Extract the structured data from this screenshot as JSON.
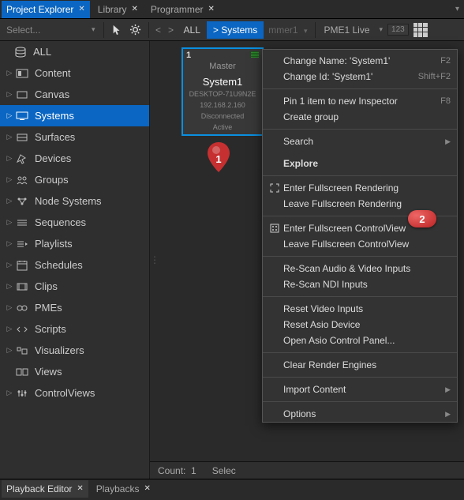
{
  "tabs": {
    "active": "Project Explorer",
    "others": [
      "Library",
      "Programmer"
    ]
  },
  "toolbar": {
    "select_placeholder": "Select...",
    "crumb_all": "ALL",
    "crumb_systems": "> Systems",
    "mmer": "mmer1",
    "pme": "PME1 Live",
    "num": "123"
  },
  "sidebar": {
    "all": "ALL",
    "items": [
      {
        "label": "Content"
      },
      {
        "label": "Canvas"
      },
      {
        "label": "Systems"
      },
      {
        "label": "Surfaces"
      },
      {
        "label": "Devices"
      },
      {
        "label": "Groups"
      },
      {
        "label": "Node Systems"
      },
      {
        "label": "Sequences"
      },
      {
        "label": "Playlists"
      },
      {
        "label": "Schedules"
      },
      {
        "label": "Clips"
      },
      {
        "label": "PMEs"
      },
      {
        "label": "Scripts"
      },
      {
        "label": "Visualizers"
      },
      {
        "label": "Views"
      },
      {
        "label": "ControlViews"
      }
    ]
  },
  "card": {
    "num": "1",
    "role": "Master",
    "title": "System1",
    "host": "DESKTOP-71U9N2E",
    "ip": "192.168.2.160",
    "state1": "Disconnected",
    "state2": "Active"
  },
  "status": {
    "count_label": "Count:",
    "count_val": "1",
    "select_label": "Selec"
  },
  "ctx": {
    "change_name": "Change Name: 'System1'",
    "change_name_short": "F2",
    "change_id": "Change Id: 'System1'",
    "change_id_short": "Shift+F2",
    "pin": "Pin 1 item to new Inspector",
    "pin_short": "F8",
    "create_group": "Create group",
    "search": "Search",
    "explore": "Explore",
    "enter_fs_render": "Enter Fullscreen Rendering",
    "leave_fs_render": "Leave Fullscreen Rendering",
    "enter_fs_ctrl": "Enter Fullscreen ControlView",
    "leave_fs_ctrl": "Leave Fullscreen ControlView",
    "rescan_av": "Re-Scan Audio & Video Inputs",
    "rescan_ndi": "Re-Scan NDI Inputs",
    "reset_video": "Reset Video Inputs",
    "reset_asio": "Reset Asio Device",
    "open_asio": "Open Asio Control Panel...",
    "clear_render": "Clear Render Engines",
    "import_content": "Import Content",
    "options": "Options"
  },
  "pins": {
    "one": "1",
    "two": "2"
  },
  "bottom_tabs": {
    "a": "Playback Editor",
    "b": "Playbacks"
  }
}
